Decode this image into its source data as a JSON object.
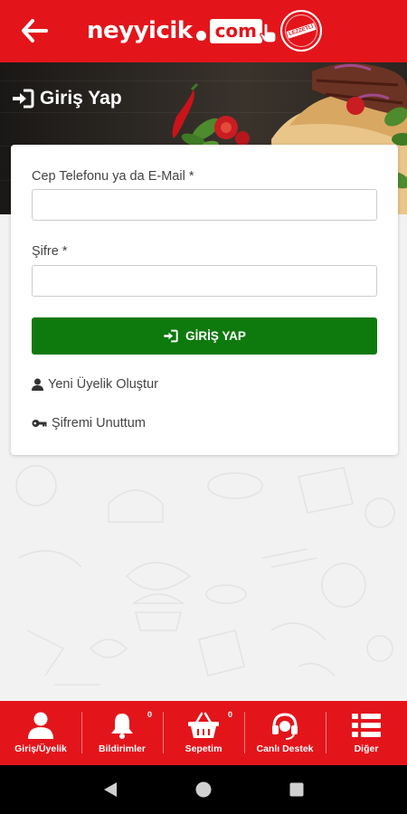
{
  "header": {
    "logo_word": "neyyicik",
    "logo_com": "com",
    "logo_stamp_text": "LEZZETLİ"
  },
  "login": {
    "title": "Giriş Yap",
    "phone_label": "Cep Telefonu ya da E-Mail *",
    "phone_value": "",
    "password_label": "Şifre *",
    "password_value": "",
    "submit_label": "GİRİŞ YAP",
    "register_link": "Yeni Üyelik Oluştur",
    "forgot_link": "Şifremi Unuttum"
  },
  "bottom_nav": {
    "items": [
      {
        "label": "Giriş/Üyelik",
        "icon": "user-icon"
      },
      {
        "label": "Bildirimler",
        "icon": "bell-icon",
        "badge": "0"
      },
      {
        "label": "Sepetim",
        "icon": "basket-icon",
        "badge": "0"
      },
      {
        "label": "Canlı Destek",
        "icon": "headset-icon"
      },
      {
        "label": "Diğer",
        "icon": "list-icon"
      }
    ]
  },
  "colors": {
    "brand_red": "#e3151b",
    "button_green": "#0e7a0d"
  }
}
